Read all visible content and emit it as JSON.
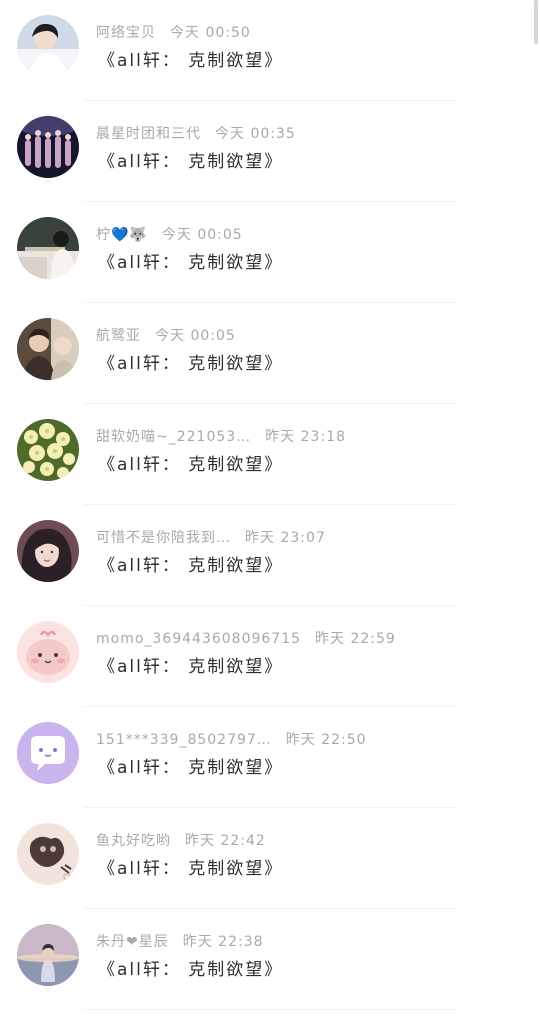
{
  "messages": [
    {
      "name": "阿络宝贝",
      "time": "今天 00:50",
      "text": "《all轩： 克制欲望》",
      "avatar_icon": "boy-portrait-avatar",
      "colors": [
        "#cfd9e8",
        "#f4f6fa",
        "#1e1e24"
      ]
    },
    {
      "name": "晨星时团和三代",
      "time": "今天 00:35",
      "text": "《all轩： 克制欲望》",
      "avatar_icon": "stage-group-avatar",
      "colors": [
        "#14162e",
        "#5a4f8c",
        "#c9a3c4"
      ]
    },
    {
      "name": "柠💙🐺",
      "time": "今天 00:05",
      "text": "《all轩： 克制欲望》",
      "avatar_icon": "classroom-avatar",
      "colors": [
        "#39433b",
        "#e9e4dc",
        "#1b1b1b"
      ]
    },
    {
      "name": "航鹭亚",
      "time": "今天 00:05",
      "text": "《all轩： 克制欲望》",
      "avatar_icon": "two-people-avatar",
      "colors": [
        "#5b4a3e",
        "#d8cdbf",
        "#2a211c"
      ]
    },
    {
      "name": "甜软奶喵~_221053…",
      "time": "昨天 23:18",
      "text": "《all轩： 克制欲望》",
      "avatar_icon": "flowers-avatar",
      "colors": [
        "#4e6b2a",
        "#f4efb6",
        "#c9cf6a"
      ]
    },
    {
      "name": "可惜不是你陪我到…",
      "time": "昨天 23:07",
      "text": "《all轩： 克制欲望》",
      "avatar_icon": "girl-portrait-avatar",
      "colors": [
        "#2a2025",
        "#efd9d2",
        "#6d4c52"
      ]
    },
    {
      "name": "momo_369443608096715",
      "time": "昨天 22:59",
      "text": "《all轩： 克制欲望》",
      "avatar_icon": "pink-cartoon-avatar",
      "colors": [
        "#f6c9c9",
        "#fbe3e1",
        "#e89898"
      ]
    },
    {
      "name": "151***339_8502797…",
      "time": "昨天 22:50",
      "text": "《all轩： 克制欲望》",
      "avatar_icon": "chat-bubble-avatar",
      "colors": [
        "#c9b4ee",
        "#ffffff",
        "#8f73c4"
      ]
    },
    {
      "name": "鱼丸好吃哟",
      "time": "昨天 22:42",
      "text": "《all轩： 克制欲望》",
      "avatar_icon": "sketch-doodle-avatar",
      "colors": [
        "#f3e3dd",
        "#4b3b38",
        "#d9b7ad"
      ]
    },
    {
      "name": "朱丹❤星辰",
      "time": "昨天 22:38",
      "text": "《all轩： 克制欲望》",
      "avatar_icon": "sunset-girl-avatar",
      "colors": [
        "#c9b9c6",
        "#8d98b0",
        "#f1d9c4"
      ]
    }
  ]
}
